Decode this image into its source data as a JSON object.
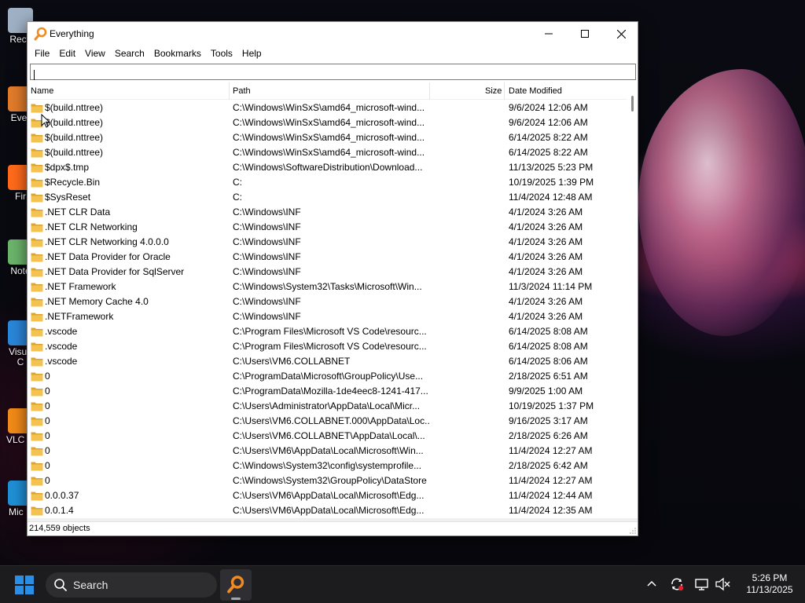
{
  "desktop": {
    "icons": [
      {
        "label": "Recy",
        "color": "#9fb0c4"
      },
      {
        "label": "Ever",
        "color": "#e07b2a"
      },
      {
        "label": "Fir",
        "color": "#ff6a1a"
      },
      {
        "label": "Note",
        "color": "#6bb36b"
      },
      {
        "label": "Visua C",
        "color": "#2a86d8"
      },
      {
        "label": "VLC pl",
        "color": "#f08a18"
      },
      {
        "label": "Mic E",
        "color": "#1f8fd4"
      }
    ]
  },
  "window": {
    "title": "Everything",
    "menu": [
      "File",
      "Edit",
      "View",
      "Search",
      "Bookmarks",
      "Tools",
      "Help"
    ],
    "search": {
      "value": "",
      "placeholder": ""
    },
    "columns": {
      "name": "Name",
      "path": "Path",
      "size": "Size",
      "date": "Date Modified"
    },
    "rows": [
      {
        "name": "$(build.nttree)",
        "path": "C:\\Windows\\WinSxS\\amd64_microsoft-wind...",
        "size": "",
        "date": "9/6/2024 12:06 AM"
      },
      {
        "name": "$(build.nttree)",
        "path": "C:\\Windows\\WinSxS\\amd64_microsoft-wind...",
        "size": "",
        "date": "9/6/2024 12:06 AM"
      },
      {
        "name": "$(build.nttree)",
        "path": "C:\\Windows\\WinSxS\\amd64_microsoft-wind...",
        "size": "",
        "date": "6/14/2025 8:22 AM"
      },
      {
        "name": "$(build.nttree)",
        "path": "C:\\Windows\\WinSxS\\amd64_microsoft-wind...",
        "size": "",
        "date": "6/14/2025 8:22 AM"
      },
      {
        "name": "$dpx$.tmp",
        "path": "C:\\Windows\\SoftwareDistribution\\Download...",
        "size": "",
        "date": "11/13/2025 5:23 PM"
      },
      {
        "name": "$Recycle.Bin",
        "path": "C:",
        "size": "",
        "date": "10/19/2025 1:39 PM"
      },
      {
        "name": "$SysReset",
        "path": "C:",
        "size": "",
        "date": "11/4/2024 12:48 AM"
      },
      {
        "name": ".NET CLR Data",
        "path": "C:\\Windows\\INF",
        "size": "",
        "date": "4/1/2024 3:26 AM"
      },
      {
        "name": ".NET CLR Networking",
        "path": "C:\\Windows\\INF",
        "size": "",
        "date": "4/1/2024 3:26 AM"
      },
      {
        "name": ".NET CLR Networking 4.0.0.0",
        "path": "C:\\Windows\\INF",
        "size": "",
        "date": "4/1/2024 3:26 AM"
      },
      {
        "name": ".NET Data Provider for Oracle",
        "path": "C:\\Windows\\INF",
        "size": "",
        "date": "4/1/2024 3:26 AM"
      },
      {
        "name": ".NET Data Provider for SqlServer",
        "path": "C:\\Windows\\INF",
        "size": "",
        "date": "4/1/2024 3:26 AM"
      },
      {
        "name": ".NET Framework",
        "path": "C:\\Windows\\System32\\Tasks\\Microsoft\\Win...",
        "size": "",
        "date": "11/3/2024 11:14 PM"
      },
      {
        "name": ".NET Memory Cache 4.0",
        "path": "C:\\Windows\\INF",
        "size": "",
        "date": "4/1/2024 3:26 AM"
      },
      {
        "name": ".NETFramework",
        "path": "C:\\Windows\\INF",
        "size": "",
        "date": "4/1/2024 3:26 AM"
      },
      {
        "name": ".vscode",
        "path": "C:\\Program Files\\Microsoft VS Code\\resourc...",
        "size": "",
        "date": "6/14/2025 8:08 AM"
      },
      {
        "name": ".vscode",
        "path": "C:\\Program Files\\Microsoft VS Code\\resourc...",
        "size": "",
        "date": "6/14/2025 8:08 AM"
      },
      {
        "name": ".vscode",
        "path": "C:\\Users\\VM6.COLLABNET",
        "size": "",
        "date": "6/14/2025 8:06 AM"
      },
      {
        "name": "0",
        "path": "C:\\ProgramData\\Microsoft\\GroupPolicy\\Use...",
        "size": "",
        "date": "2/18/2025 6:51 AM"
      },
      {
        "name": "0",
        "path": "C:\\ProgramData\\Mozilla-1de4eec8-1241-417...",
        "size": "",
        "date": "9/9/2025 1:00 AM"
      },
      {
        "name": "0",
        "path": "C:\\Users\\Administrator\\AppData\\Local\\Micr...",
        "size": "",
        "date": "10/19/2025 1:37 PM"
      },
      {
        "name": "0",
        "path": "C:\\Users\\VM6.COLLABNET.000\\AppData\\Loc...",
        "size": "",
        "date": "9/16/2025 3:17 AM"
      },
      {
        "name": "0",
        "path": "C:\\Users\\VM6.COLLABNET\\AppData\\Local\\...",
        "size": "",
        "date": "2/18/2025 6:26 AM"
      },
      {
        "name": "0",
        "path": "C:\\Users\\VM6\\AppData\\Local\\Microsoft\\Win...",
        "size": "",
        "date": "11/4/2024 12:27 AM"
      },
      {
        "name": "0",
        "path": "C:\\Windows\\System32\\config\\systemprofile...",
        "size": "",
        "date": "2/18/2025 6:42 AM"
      },
      {
        "name": "0",
        "path": "C:\\Windows\\System32\\GroupPolicy\\DataStore",
        "size": "",
        "date": "11/4/2024 12:27 AM"
      },
      {
        "name": "0.0.0.37",
        "path": "C:\\Users\\VM6\\AppData\\Local\\Microsoft\\Edg...",
        "size": "",
        "date": "11/4/2024 12:44 AM"
      },
      {
        "name": "0.0.1.4",
        "path": "C:\\Users\\VM6\\AppData\\Local\\Microsoft\\Edg...",
        "size": "",
        "date": "11/4/2024 12:35 AM"
      }
    ],
    "status": "214,559 objects"
  },
  "taskbar": {
    "search_label": "Search",
    "time": "5:26 PM",
    "date": "11/13/2025"
  },
  "colors": {
    "folder": "#f3c24f",
    "folder_dark": "#dca531",
    "everything_orange": "#f08a24",
    "windows_blue": "#2b8ee6"
  }
}
